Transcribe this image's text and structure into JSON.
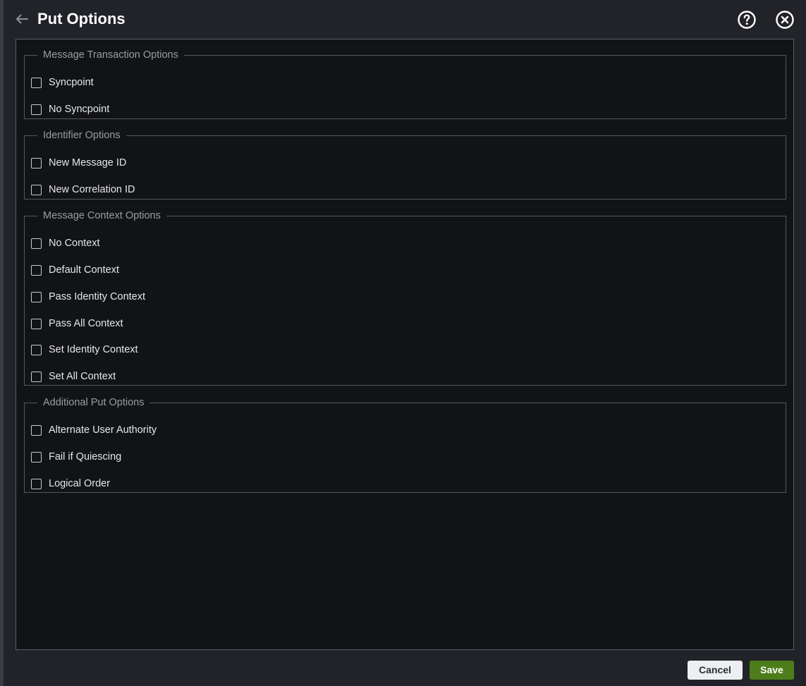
{
  "header": {
    "title": "Put Options",
    "back_icon": "arrow-left-icon",
    "help_icon": "question-circle-icon",
    "close_icon": "close-circle-icon"
  },
  "sections": [
    {
      "legend": "Message Transaction Options",
      "options": [
        {
          "label": "Syncpoint",
          "checked": false
        },
        {
          "label": "No Syncpoint",
          "checked": false
        }
      ]
    },
    {
      "legend": "Identifier Options",
      "options": [
        {
          "label": "New Message ID",
          "checked": false
        },
        {
          "label": "New Correlation ID",
          "checked": false
        }
      ]
    },
    {
      "legend": "Message Context Options",
      "options": [
        {
          "label": "No Context",
          "checked": false
        },
        {
          "label": "Default Context",
          "checked": false
        },
        {
          "label": "Pass Identity Context",
          "checked": false
        },
        {
          "label": "Pass All Context",
          "checked": false
        },
        {
          "label": "Set Identity Context",
          "checked": false
        },
        {
          "label": "Set All Context",
          "checked": false
        }
      ]
    },
    {
      "legend": "Additional Put Options",
      "options": [
        {
          "label": "Alternate User Authority",
          "checked": false
        },
        {
          "label": "Fail if Quiescing",
          "checked": false
        },
        {
          "label": "Logical Order",
          "checked": false
        }
      ]
    }
  ],
  "footer": {
    "cancel_label": "Cancel",
    "save_label": "Save"
  },
  "colors": {
    "background": "#121316",
    "dialog": "#222328",
    "save_button": "#4c7d1a",
    "cancel_button": "#eceef1"
  }
}
